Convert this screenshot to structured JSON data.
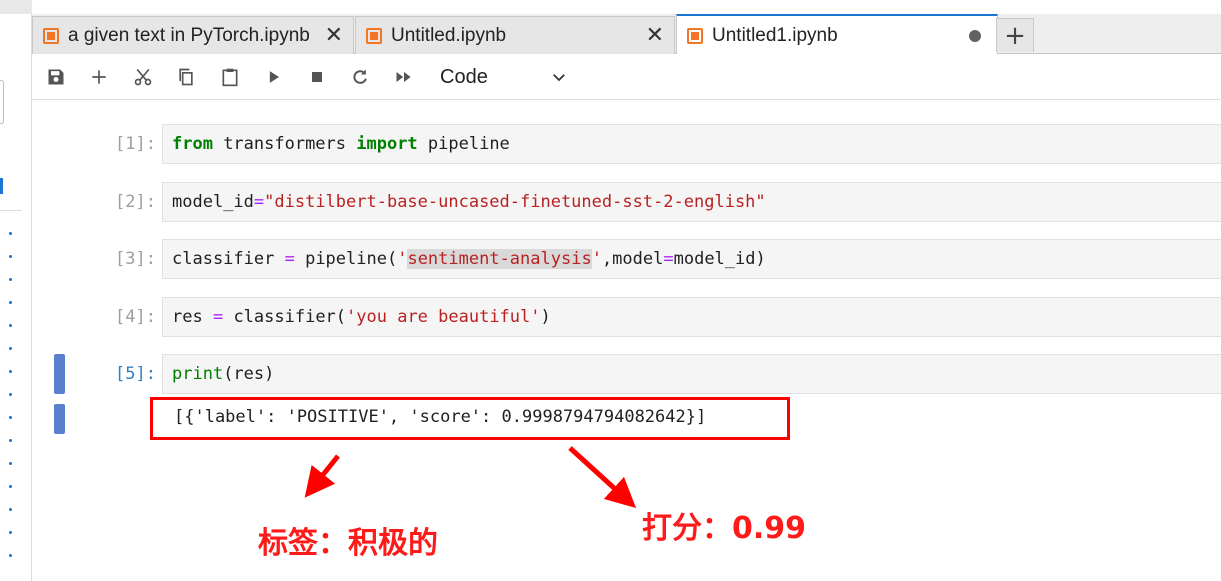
{
  "tabs": [
    {
      "label": "a given text in PyTorch.ipynb",
      "close": "✕",
      "active": false
    },
    {
      "label": "Untitled.ipynb",
      "close": "✕",
      "active": false
    },
    {
      "label": "Untitled1.ipynb",
      "active": true,
      "dirty": true
    }
  ],
  "add_tab_label": "+",
  "toolbar": {
    "icons": [
      "save-icon",
      "add-cell-icon",
      "cut-icon",
      "copy-icon",
      "paste-icon",
      "run-icon",
      "stop-icon",
      "restart-icon",
      "run-all-icon"
    ],
    "cell_type": "Code"
  },
  "cells": [
    {
      "prompt": "[1]:"
    },
    {
      "prompt": "[2]:"
    },
    {
      "prompt": "[3]:"
    },
    {
      "prompt": "[4]:"
    },
    {
      "prompt": "[5]:",
      "output": "[{'label': 'POSITIVE', 'score': 0.9998794794082642}]"
    }
  ],
  "code": {
    "c1": {
      "kw1": "from",
      "mod": " transformers ",
      "kw2": "import",
      "name": " pipeline"
    },
    "c2": {
      "var": "model_id",
      "eq": "=",
      "str": "\"distilbert-base-uncased-finetuned-sst-2-english\""
    },
    "c3": {
      "var": "classifier ",
      "eq": "=",
      "call": " pipeline(",
      "q1": "'",
      "task": "sentiment-analysis",
      "q2": "'",
      "rest1": ",model",
      "eq2": "=",
      "rest2": "model_id)"
    },
    "c4": {
      "var": "res ",
      "eq": "=",
      "call": " classifier(",
      "str": "'you are beautiful'",
      "close": ")"
    },
    "c5": {
      "fn": "print",
      "args": "(res)"
    }
  },
  "annotations": {
    "label_note": "标签：积极的",
    "score_note": "打分：0.99"
  },
  "colors": {
    "annotation": "#ff0000",
    "accent": "#1976d2",
    "notebook_icon": "#f37626"
  }
}
